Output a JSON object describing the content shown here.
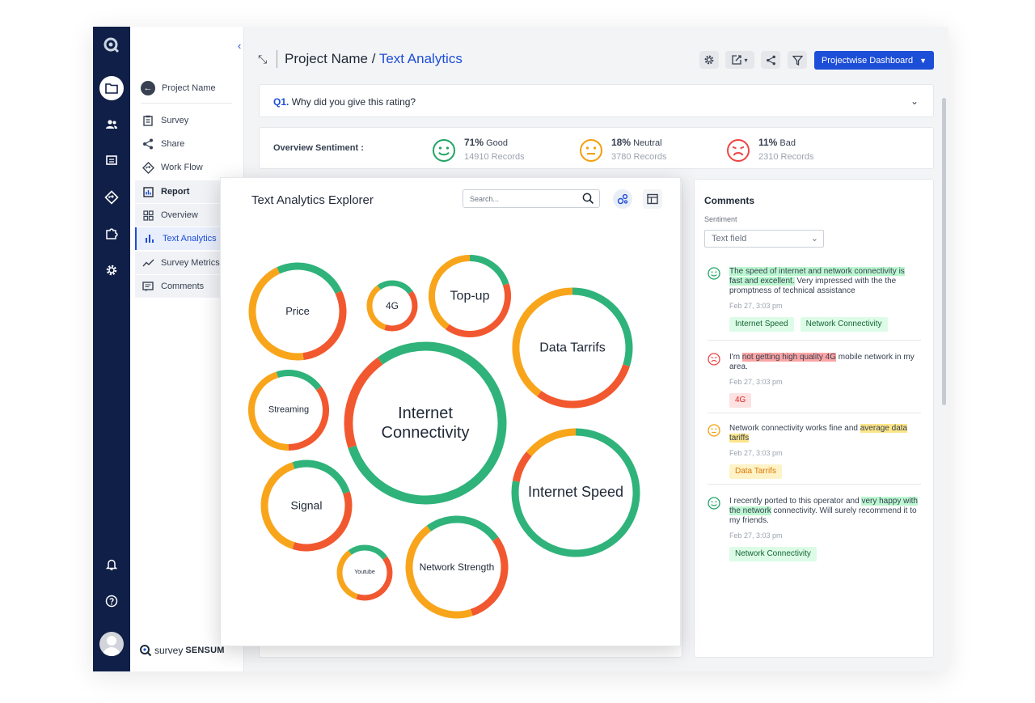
{
  "breadcrumb": {
    "project": "Project Name / ",
    "page": "Text Analytics"
  },
  "header": {
    "dashboard_button": "Projectwise Dashboard"
  },
  "sidebar": {
    "back_label": "Project Name",
    "items": [
      {
        "label": "Survey",
        "icon": "clipboard-icon"
      },
      {
        "label": "Share",
        "icon": "share-icon"
      },
      {
        "label": "Work Flow",
        "icon": "workflow-icon"
      },
      {
        "label": "Report",
        "icon": "report-icon"
      },
      {
        "label": "Overview",
        "icon": "overview-icon"
      },
      {
        "label": "Text Analytics",
        "icon": "bar-chart-icon"
      },
      {
        "label": "Survey Metrics",
        "icon": "trend-icon"
      },
      {
        "label": "Comments",
        "icon": "comment-icon"
      }
    ],
    "brand_light": "survey",
    "brand_bold": "SENSUM"
  },
  "question": {
    "number": "Q1.",
    "text": "Why did you give this rating?"
  },
  "overview": {
    "label": "Overview Sentiment :",
    "good": {
      "pct": "71%",
      "label": "Good",
      "records": "14910 Records",
      "color": "#22a464"
    },
    "neutral": {
      "pct": "18%",
      "label": "Neutral",
      "records": "3780 Records",
      "color": "#f59e0b"
    },
    "bad": {
      "pct": "11%",
      "label": "Bad",
      "records": "2310 Records",
      "color": "#ef4444"
    }
  },
  "explorer": {
    "title": "Text Analytics Explorer",
    "search_placeholder": "Search...",
    "topics": [
      {
        "label": "Price",
        "positive": 0.25,
        "neutral": 0.45,
        "negative": 0.3
      },
      {
        "label": "4G",
        "positive": 0.25,
        "neutral": 0.35,
        "negative": 0.4
      },
      {
        "label": "Top-up",
        "positive": 0.2,
        "neutral": 0.4,
        "negative": 0.4
      },
      {
        "label": "Data Tarrifs",
        "positive": 0.3,
        "neutral": 0.4,
        "negative": 0.3
      },
      {
        "label": "Streaming",
        "positive": 0.2,
        "neutral": 0.45,
        "negative": 0.35
      },
      {
        "label": "Internet Connectivity",
        "positive": 0.8,
        "neutral": 0.0,
        "negative": 0.2
      },
      {
        "label": "Internet Speed",
        "positive": 0.78,
        "neutral": 0.14,
        "negative": 0.08
      },
      {
        "label": "Signal",
        "positive": 0.25,
        "neutral": 0.4,
        "negative": 0.35
      },
      {
        "label": "Youtube",
        "positive": 0.25,
        "neutral": 0.35,
        "negative": 0.4
      },
      {
        "label": "Network Strength",
        "positive": 0.25,
        "neutral": 0.45,
        "negative": 0.3
      }
    ]
  },
  "comments": {
    "title": "Comments",
    "sentiment_label": "Sentiment",
    "filter_value": "Text field",
    "items": [
      {
        "sentiment": "positive",
        "highlight": "The speed of internet and network connectivity is fast and excellent.",
        "rest": " Very impressed with the the promptness of technical assistance",
        "time": "Feb 27, 3:03 pm",
        "tags": [
          "Internet Speed",
          "Network Connectivity"
        ]
      },
      {
        "sentiment": "negative",
        "pre": "I'm ",
        "highlight": "not getting high quality 4G",
        "rest": " mobile network in my area.",
        "time": "Feb 27, 3:03 pm",
        "tags": [
          "4G"
        ]
      },
      {
        "sentiment": "neutral",
        "pre": "Network connectivity works fine and ",
        "highlight": "average data tariffs",
        "time": "Feb 27, 3:03 pm",
        "tags": [
          "Data Tarrifs"
        ]
      },
      {
        "sentiment": "positive",
        "pre": "I recently ported to this operator and ",
        "highlight": "very happy with the network",
        "rest": " connectivity. Will surely recommend it to my friends.",
        "time": "Feb 27, 3:03 pm",
        "tags": [
          "Network Connectivity"
        ]
      }
    ]
  },
  "colors": {
    "positive": "#2fb37a",
    "neutral": "#f8a51b",
    "negative": "#f2582f",
    "accent": "#1d4ed8",
    "rail": "#0f1f47"
  }
}
